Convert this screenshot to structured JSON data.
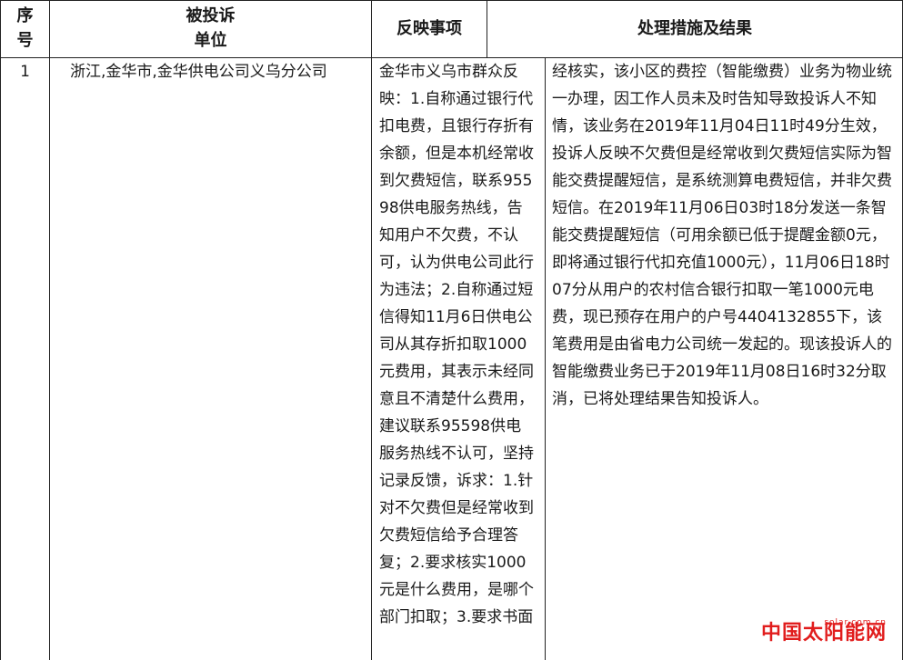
{
  "headers": {
    "seq_line1": "序",
    "seq_line2": "号",
    "unit_line1": "被投诉",
    "unit_line2": "单位",
    "issue": "反映事项",
    "result": "处理措施及结果"
  },
  "rows": [
    {
      "seq": "1",
      "unit": "浙江,金华市,金华供电公司义乌分公司",
      "issue": "金华市义乌市群众反映：1.自称通过银行代扣电费，且银行存折有余额，但是本机经常收到欠费短信，联系95598供电服务热线，告知用户不欠费，不认可，认为供电公司此行为违法；2.自称通过短信得知11月6日供电公司从其存折扣取1000元费用，其表示未经同意且不清楚什么费用，建议联系95598供电服务热线不认可，坚持记录反馈，诉求：1.针对不欠费但是经常收到欠费短信给予合理答复；2.要求核实1000元是什么费用，是哪个部门扣取；3.要求书面",
      "result": "经核实，该小区的费控（智能缴费）业务为物业统一办理，因工作人员未及时告知导致投诉人不知情，该业务在2019年11月04日11时49分生效，投诉人反映不欠费但是经常收到欠费短信实际为智能交费提醒短信，是系统测算电费短信，并非欠费短信。在2019年11月06日03时18分发送一条智能交费提醒短信（可用余额已低于提醒金额0元，即将通过银行代扣充值1000元），11月06日18时07分从用户的农村信合银行扣取一笔1000元电费，现已预存在用户的户号4404132855下，该笔费用是由省电力公司统一发起的。现该投诉人的智能缴费业务已于2019年11月08日16时32分取消，已将处理结果告知投诉人。"
    }
  ],
  "watermark": {
    "text": "中国太阳能网",
    "small": "solar.com.cn"
  }
}
